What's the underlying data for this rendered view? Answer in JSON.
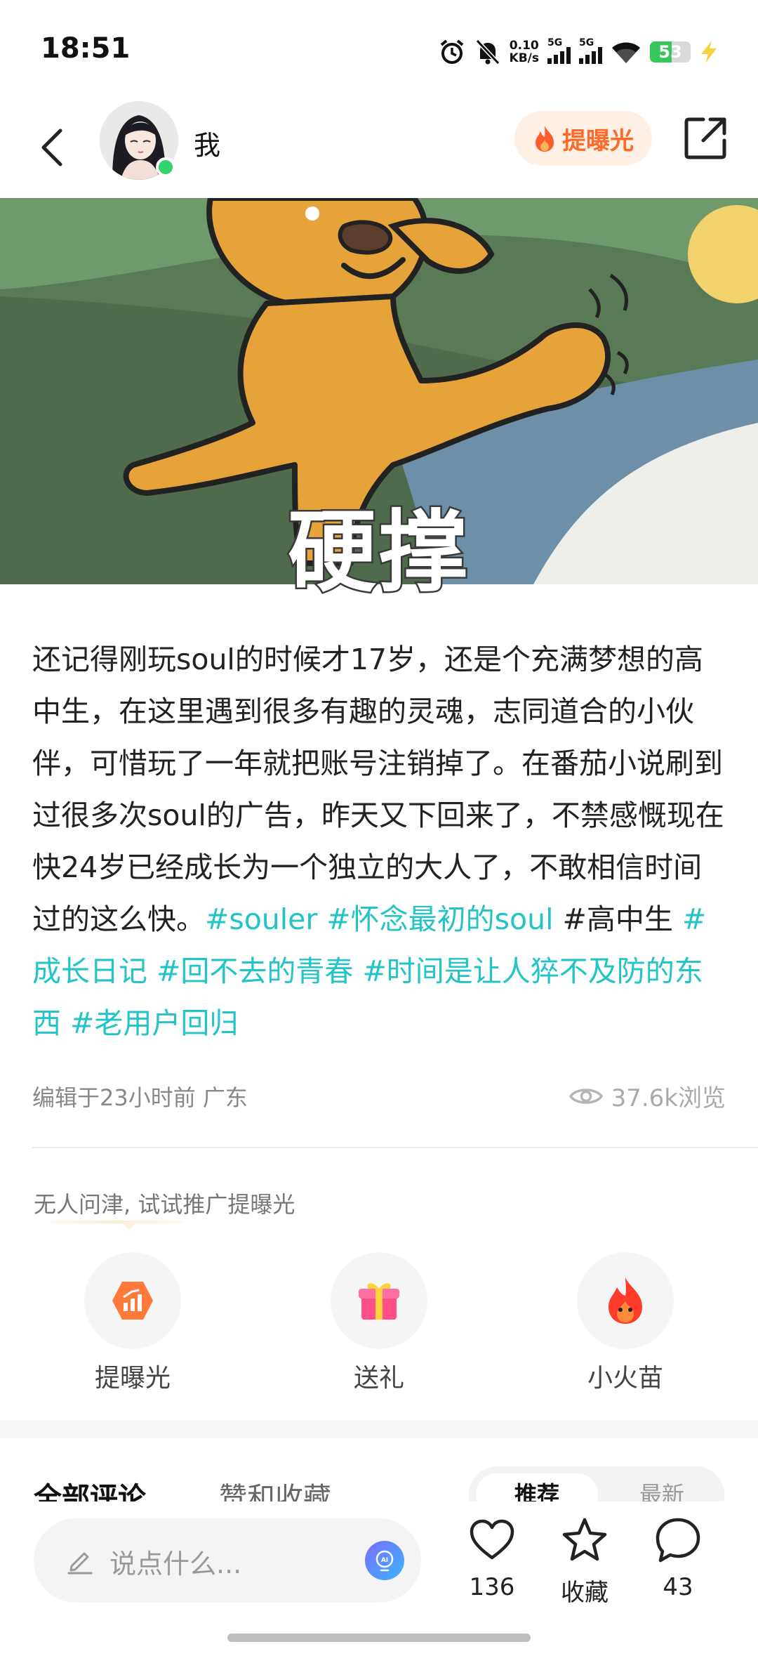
{
  "status_bar": {
    "time": "18:51",
    "net_speed_value": "0.10",
    "net_speed_unit": "KB/s",
    "signal1_label": "5G",
    "signal2_label": "5G",
    "battery_level": "53",
    "icons": [
      "alarm-icon",
      "mute-icon",
      "signal-icon",
      "wifi-icon",
      "battery-icon",
      "charging-icon"
    ]
  },
  "header": {
    "name": "我",
    "boost_label": "提曝光",
    "icons": [
      "back-icon",
      "avatar",
      "flame-icon",
      "share-icon"
    ]
  },
  "post": {
    "overlay_text": "硬撑",
    "body_text": "还记得刚玩soul的时候才17岁，还是个充满梦想的高中生，在这里遇到很多有趣的灵魂，志同道合的小伙伴，可惜玩了一年就把账号注销掉了。在番茄小说刷到过很多次soul的广告，昨天又下回来了，不禁感慨现在快24岁已经成长为一个独立的大人了，不敢相信时间过的这么快。",
    "tags": [
      {
        "text": "#souler ",
        "style": "tag"
      },
      {
        "text": " #怀念最初的soul ",
        "style": "tag"
      },
      {
        "text": "#高中生 ",
        "style": "plain"
      },
      {
        "text": "#成长日记  ",
        "style": "tag"
      },
      {
        "text": " #回不去的青春 ",
        "style": "tag"
      },
      {
        "text": "#时间是让人猝不及防的东西 ",
        "style": "tag"
      },
      {
        "text": "#老用户回归",
        "style": "tag"
      }
    ],
    "edited": "编辑于23小时前 广东",
    "views": "37.6k浏览"
  },
  "promo": {
    "hint": "无人问津, 试试推广提曝光",
    "actions": [
      {
        "label": "提曝光",
        "icon": "boost-chart-icon"
      },
      {
        "label": "送礼",
        "icon": "gift-icon"
      },
      {
        "label": "小火苗",
        "icon": "fire-mascot-icon"
      }
    ]
  },
  "comments": {
    "tab_all": "全部评论",
    "tab_likes": "赞和收藏",
    "sort_active": "推荐",
    "sort_other": "最新"
  },
  "bottom_bar": {
    "input_placeholder": "说点什么...",
    "likes_count": "136",
    "collect_label": "收藏",
    "comments_count": "43"
  },
  "colors": {
    "accent_tag": "#22c4c6",
    "boost_orange": "#ff6a2b",
    "online_green": "#35d36b"
  }
}
